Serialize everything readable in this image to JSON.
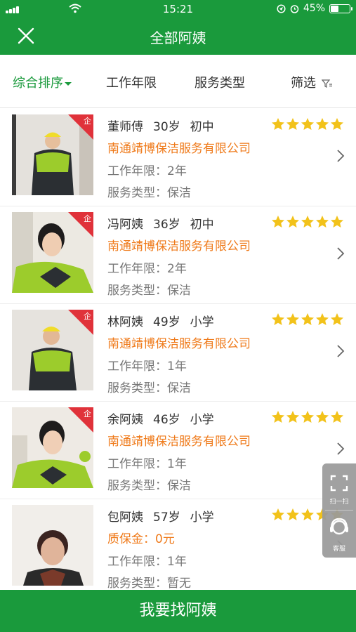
{
  "status_bar": {
    "time": "15:21",
    "battery_percent": "45%",
    "battery_level": 0.45
  },
  "header": {
    "title": "全部阿姨"
  },
  "filters": [
    {
      "label": "综合排序",
      "active": true
    },
    {
      "label": "工作年限"
    },
    {
      "label": "服务类型"
    },
    {
      "label": "筛选"
    }
  ],
  "workers": [
    {
      "name": "董师傅",
      "age": "30岁",
      "education": "初中",
      "line2": "南通靖博保洁服务有限公司",
      "experience": "工作年限：2年",
      "service": "服务类型：保洁",
      "rating": 5,
      "badge": "企"
    },
    {
      "name": "冯阿姨",
      "age": "36岁",
      "education": "初中",
      "line2": "南通靖博保洁服务有限公司",
      "experience": "工作年限：2年",
      "service": "服务类型：保洁",
      "rating": 5,
      "badge": "企"
    },
    {
      "name": "林阿姨",
      "age": "49岁",
      "education": "小学",
      "line2": "南通靖博保洁服务有限公司",
      "experience": "工作年限：1年",
      "service": "服务类型：保洁",
      "rating": 5,
      "badge": "企"
    },
    {
      "name": "余阿姨",
      "age": "46岁",
      "education": "小学",
      "line2": "南通靖博保洁服务有限公司",
      "experience": "工作年限：1年",
      "service": "服务类型：保洁",
      "rating": 5,
      "badge": "企"
    },
    {
      "name": "包阿姨",
      "age": "57岁",
      "education": "小学",
      "line2": "质保金：0元",
      "experience": "工作年限：1年",
      "service": "服务类型：暂无",
      "rating": 5,
      "badge": ""
    }
  ],
  "side_tools": {
    "scan_label": "扫一扫",
    "service_label": "客服"
  },
  "bottom": {
    "cta_label": "我要找阿姨"
  },
  "colors": {
    "brand_green": "#1a9a3c",
    "accent_orange": "#ef7a1a",
    "star_yellow": "#f2c21a",
    "badge_red": "#e0323a"
  }
}
